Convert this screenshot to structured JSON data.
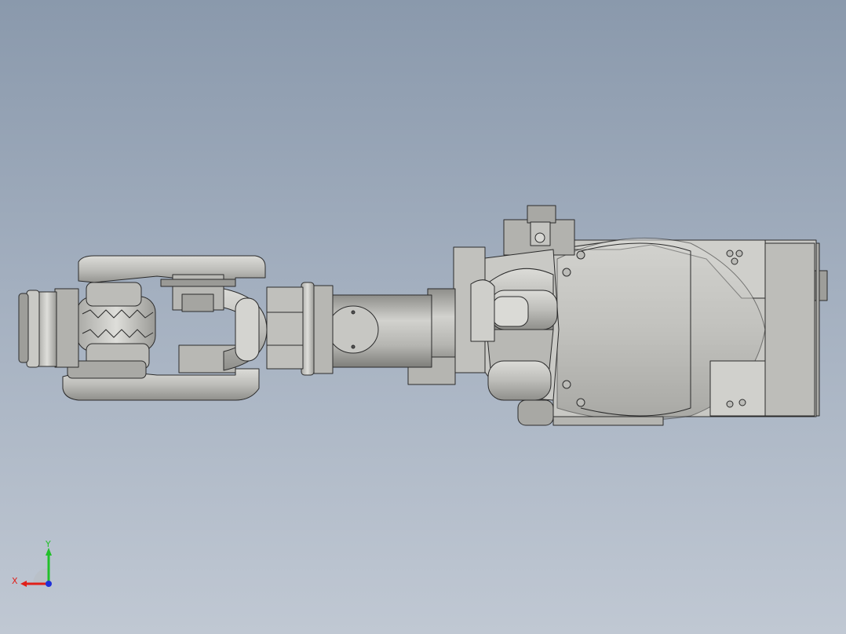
{
  "viewport": {
    "background_top": "#8a99ac",
    "background_bottom": "#c0c8d3"
  },
  "model": {
    "part_fill": "#c4c4c0",
    "part_fill_light": "#d9d9d5",
    "part_fill_dark": "#9c9c98",
    "edge_color": "#2b2b2b"
  },
  "triad": {
    "x_label": "X",
    "y_label": "Y",
    "x_color": "#e0201a",
    "y_color": "#22c02a",
    "z_color": "#2030d8"
  }
}
